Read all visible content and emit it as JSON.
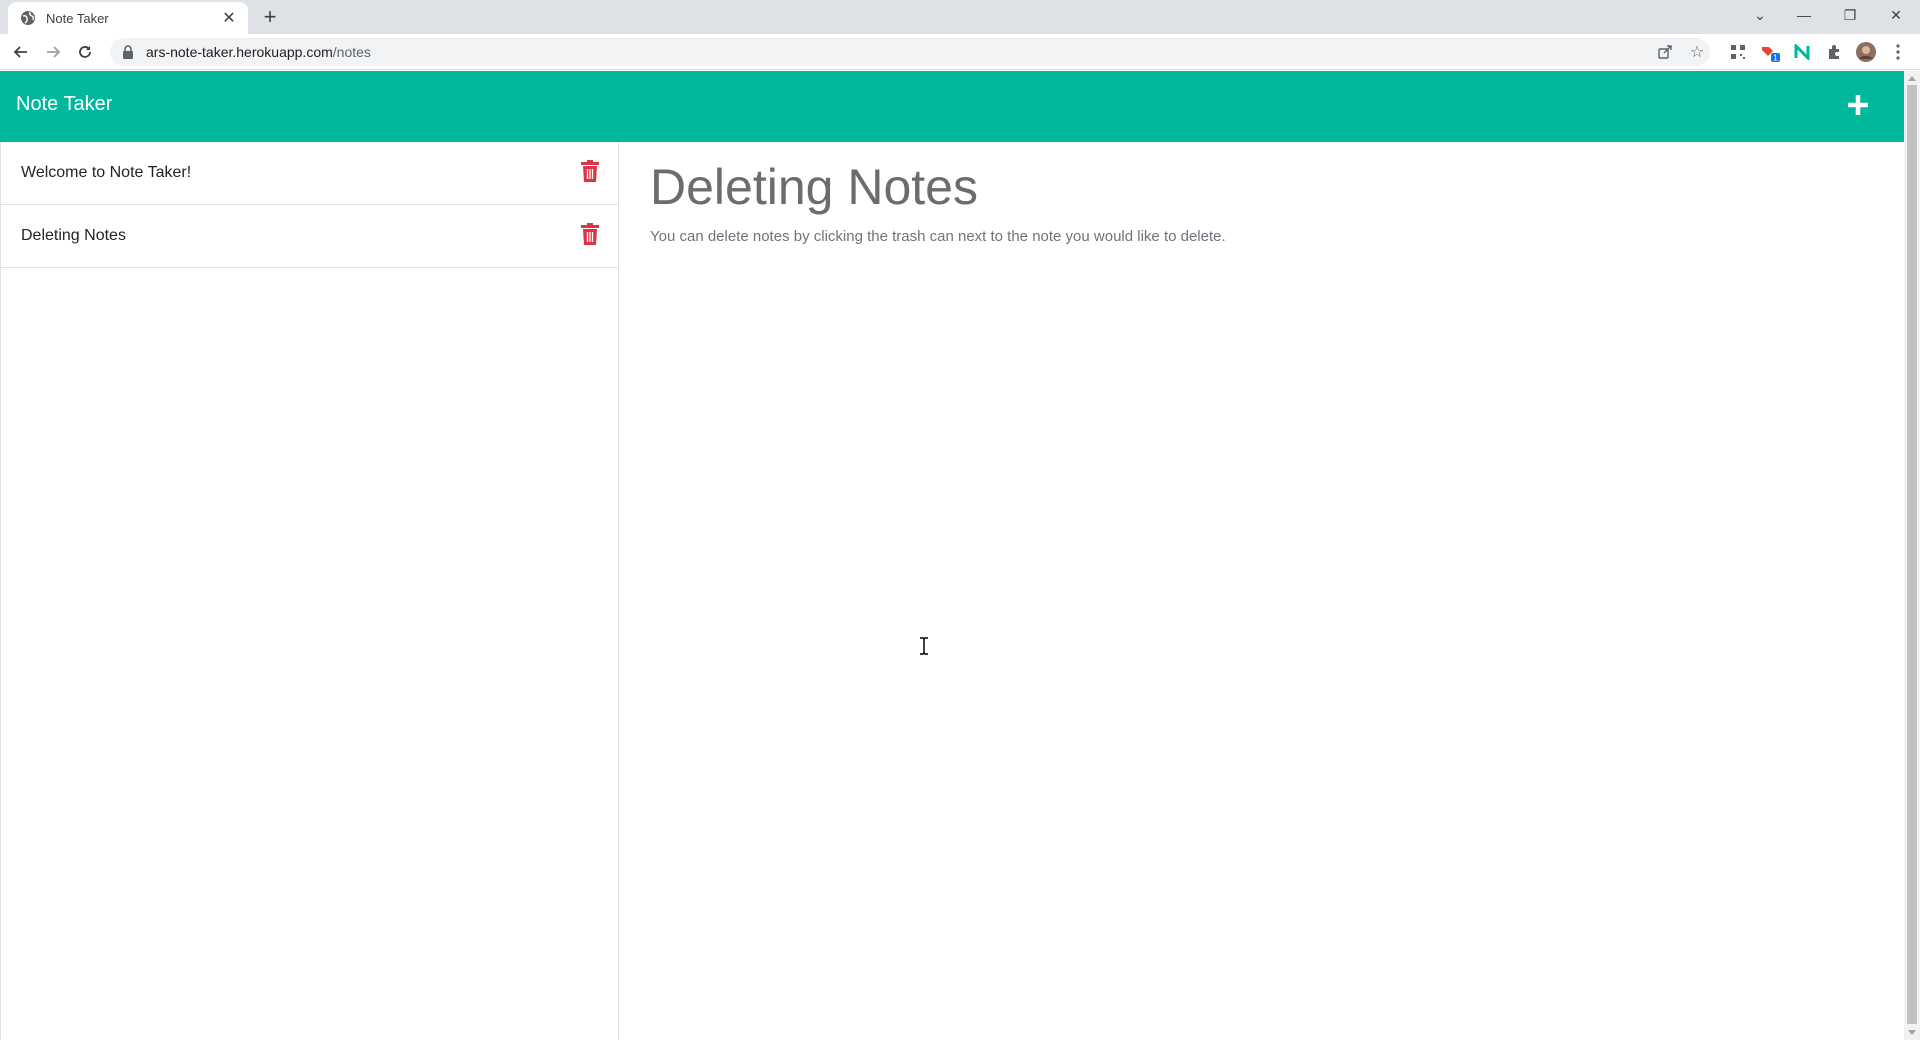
{
  "browser": {
    "tab_title": "Note Taker",
    "url_host": "ars-note-taker.herokuapp.com",
    "url_path": "/notes",
    "extension_badge": "1"
  },
  "app": {
    "brand": "Note Taker",
    "accent_color": "#00b99c",
    "delete_color": "#dc3545"
  },
  "notes": [
    {
      "title": "Welcome to Note Taker!"
    },
    {
      "title": "Deleting Notes"
    }
  ],
  "active_note": {
    "title": "Deleting Notes",
    "text": "You can delete notes by clicking the trash can next to the note you would like to delete."
  }
}
